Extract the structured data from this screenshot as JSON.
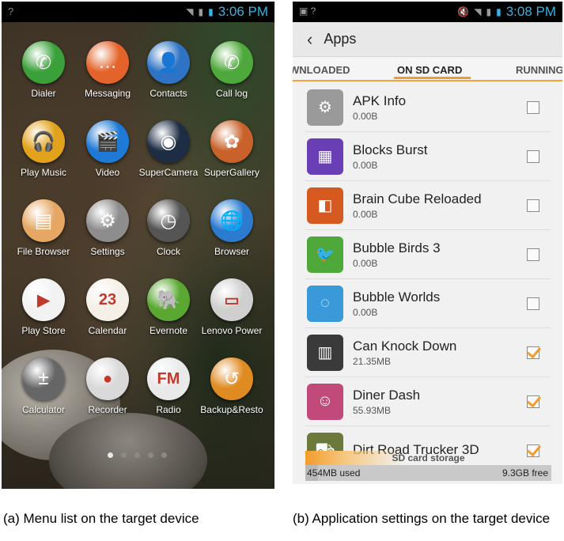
{
  "left": {
    "status_time": "3:06 PM",
    "apps": [
      {
        "label": "Dialer",
        "icon": "phone-icon",
        "glyph": "✆",
        "color": "#3aa13a"
      },
      {
        "label": "Messaging",
        "icon": "message-icon",
        "glyph": "…",
        "color": "#e3632a"
      },
      {
        "label": "Contacts",
        "icon": "contacts-icon",
        "glyph": "👤",
        "color": "#2f74c4"
      },
      {
        "label": "Call log",
        "icon": "call-log-icon",
        "glyph": "✆",
        "color": "#4ea83b"
      },
      {
        "label": "Play Music",
        "icon": "headphones-icon",
        "glyph": "🎧",
        "color": "#e2a21b"
      },
      {
        "label": "Video",
        "icon": "video-icon",
        "glyph": "🎬",
        "color": "#1f7ad6"
      },
      {
        "label": "SuperCamera",
        "icon": "camera-icon",
        "glyph": "◉",
        "color": "#1d2d44"
      },
      {
        "label": "SuperGallery",
        "icon": "gallery-icon",
        "glyph": "✿",
        "color": "#c9622a"
      },
      {
        "label": "File Browser",
        "icon": "folder-icon",
        "glyph": "▤",
        "color": "#e5a763"
      },
      {
        "label": "Settings",
        "icon": "gear-icon",
        "glyph": "⚙",
        "color": "#8d8d8d"
      },
      {
        "label": "Clock",
        "icon": "clock-icon",
        "glyph": "◷",
        "color": "#555555"
      },
      {
        "label": "Browser",
        "icon": "globe-icon",
        "glyph": "🌐",
        "color": "#2b7bd1"
      },
      {
        "label": "Play Store",
        "icon": "play-store-icon",
        "glyph": "▶",
        "color": "#f2f2f2"
      },
      {
        "label": "Calendar",
        "icon": "calendar-icon",
        "glyph": "23",
        "color": "#f4f0e8"
      },
      {
        "label": "Evernote",
        "icon": "evernote-icon",
        "glyph": "🐘",
        "color": "#5aa832"
      },
      {
        "label": "Lenovo Power",
        "icon": "battery-icon",
        "glyph": "▭",
        "color": "#cfcfcf"
      },
      {
        "label": "Calculator",
        "icon": "calculator-icon",
        "glyph": "±",
        "color": "#666666"
      },
      {
        "label": "Recorder",
        "icon": "record-icon",
        "glyph": "●",
        "color": "#d9d9d9"
      },
      {
        "label": "Radio",
        "icon": "radio-icon",
        "glyph": "FM",
        "color": "#e9e9e9"
      },
      {
        "label": "Backup&Resto",
        "icon": "backup-icon",
        "glyph": "↺",
        "color": "#e08b21"
      }
    ],
    "page_dots": 5,
    "active_dot": 0
  },
  "right": {
    "status_time": "3:08 PM",
    "title": "Apps",
    "tabs": [
      "WNLOADED",
      "ON SD CARD",
      "RUNNING"
    ],
    "active_tab": 1,
    "apps": [
      {
        "name": "APK Info",
        "size": "0.00B",
        "checked": false,
        "icon": "gear-icon",
        "glyph": "⚙",
        "color": "#9a9a9a"
      },
      {
        "name": "Blocks Burst",
        "size": "0.00B",
        "checked": false,
        "icon": "blocks-icon",
        "glyph": "▦",
        "color": "#6a3fb5"
      },
      {
        "name": "Brain Cube Reloaded",
        "size": "0.00B",
        "checked": false,
        "icon": "cube-icon",
        "glyph": "◧",
        "color": "#d65a1f"
      },
      {
        "name": "Bubble Birds 3",
        "size": "0.00B",
        "checked": false,
        "icon": "bird-icon",
        "glyph": "🐦",
        "color": "#4fa83a"
      },
      {
        "name": "Bubble Worlds",
        "size": "0.00B",
        "checked": false,
        "icon": "bubbles-icon",
        "glyph": "◌",
        "color": "#3a9ad9"
      },
      {
        "name": "Can Knock Down",
        "size": "21.35MB",
        "checked": true,
        "icon": "cans-icon",
        "glyph": "▥",
        "color": "#3a3a3a"
      },
      {
        "name": "Diner Dash",
        "size": "55.93MB",
        "checked": true,
        "icon": "waitress-icon",
        "glyph": "☺",
        "color": "#c24a7a"
      },
      {
        "name": "Dirt Road Trucker 3D",
        "size": "",
        "checked": true,
        "icon": "truck-icon",
        "glyph": "⛟",
        "color": "#6b7a3a"
      }
    ],
    "storage": {
      "label": "SD card storage",
      "used": "454MB used",
      "free": "9.3GB free",
      "used_fraction": 0.05
    }
  },
  "captions": {
    "left": "(a) Menu list on the target device",
    "right": "(b) Application settings on the target device"
  }
}
